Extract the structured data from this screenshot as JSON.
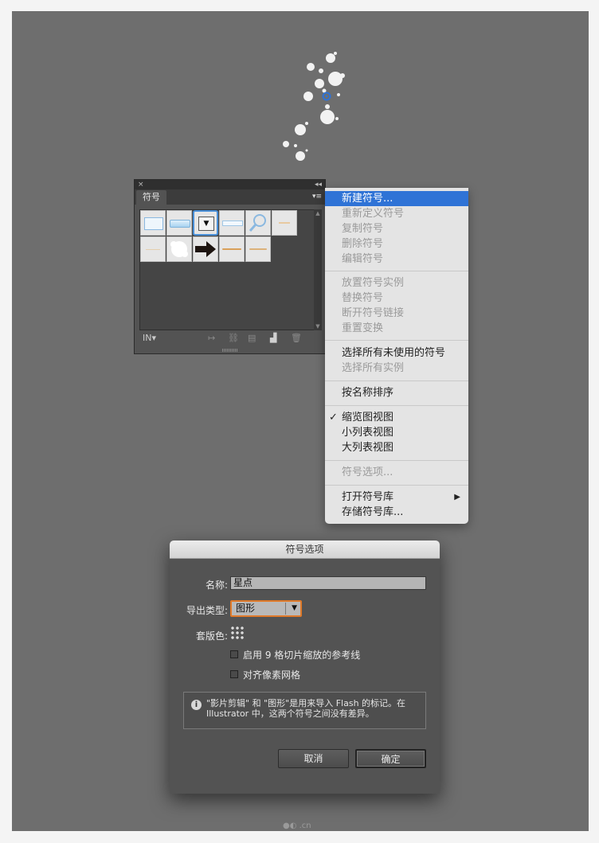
{
  "panel": {
    "close_glyph": "×",
    "collapse_glyph": "◂◂",
    "tab_label": "符号",
    "menu_glyph": "▾≡",
    "library_icon_label": "IN▾"
  },
  "menu": {
    "items": [
      {
        "label": "新建符号...",
        "state": "selected"
      },
      {
        "label": "重新定义符号",
        "state": "disabled"
      },
      {
        "label": "复制符号",
        "state": "disabled"
      },
      {
        "label": "删除符号",
        "state": "disabled"
      },
      {
        "label": "编辑符号",
        "state": "disabled"
      },
      {
        "label": "放置符号实例",
        "state": "disabled"
      },
      {
        "label": "替换符号",
        "state": "disabled"
      },
      {
        "label": "断开符号链接",
        "state": "disabled"
      },
      {
        "label": "重置变换",
        "state": "disabled"
      },
      {
        "label": "选择所有未使用的符号",
        "state": "enabled"
      },
      {
        "label": "选择所有实例",
        "state": "disabled"
      },
      {
        "label": "按名称排序",
        "state": "enabled"
      },
      {
        "label": "缩览图视图",
        "state": "checked"
      },
      {
        "label": "小列表视图",
        "state": "enabled"
      },
      {
        "label": "大列表视图",
        "state": "enabled"
      },
      {
        "label": "符号选项...",
        "state": "disabled"
      },
      {
        "label": "打开符号库",
        "state": "submenu"
      },
      {
        "label": "存储符号库...",
        "state": "enabled"
      }
    ],
    "check_glyph": "✓",
    "submenu_glyph": "▶"
  },
  "dialog": {
    "title": "符号选项",
    "name_label": "名称:",
    "name_value": "星点",
    "export_type_label": "导出类型:",
    "export_type_value": "图形",
    "registration_label": "套版色:",
    "option_9slice": "启用 9 格切片缩放的参考线",
    "option_pixel_grid": "对齐像素网格",
    "info_icon": "i",
    "info_line1": "\"影片剪辑\" 和 \"图形\"是用来导入 Flash 的标记。在",
    "info_line2": "Illustrator 中，这两个符号之间没有差异。",
    "cancel_label": "取消",
    "ok_label": "确定"
  },
  "colors": {
    "canvas": "#6e6e6e",
    "menu_highlight": "#2f73d6",
    "focus_ring": "#e07a2a"
  }
}
